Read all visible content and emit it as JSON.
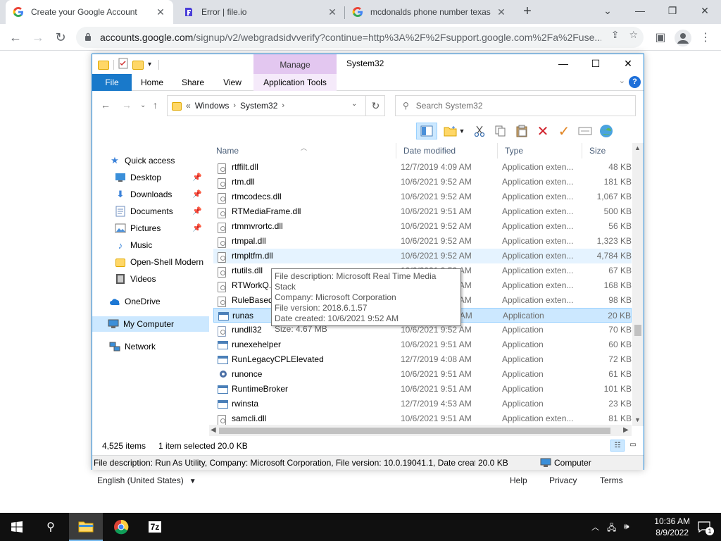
{
  "browser": {
    "tabs": [
      {
        "title": "Create your Google Account",
        "icon": "google-g-icon"
      },
      {
        "title": "Error | file.io",
        "icon": "fileio-icon"
      },
      {
        "title": "mcdonalds phone number texas",
        "icon": "google-g-icon"
      }
    ],
    "url_host": "accounts.google.com",
    "url_path": "/signup/v2/webgradsidvverify?continue=http%3A%2F%2Fsupport.google.com%2Fa%2Fuse..."
  },
  "page": {
    "language": "English (United States)",
    "links": [
      "Help",
      "Privacy",
      "Terms"
    ]
  },
  "explorer": {
    "window_title": "System32",
    "manage_label": "Manage",
    "ribbon_tabs": [
      "File",
      "Home",
      "Share",
      "View",
      "Application Tools"
    ],
    "breadcrumb": [
      "Windows",
      "System32"
    ],
    "breadcrumb_prefix": "«",
    "search_placeholder": "Search System32",
    "nav": {
      "quick_access": "Quick access",
      "items": [
        "Desktop",
        "Downloads",
        "Documents",
        "Pictures",
        "Music",
        "Open-Shell Modern",
        "Videos"
      ],
      "onedrive": "OneDrive",
      "my_computer": "My Computer",
      "network": "Network"
    },
    "columns": [
      "Name",
      "Date modified",
      "Type",
      "Size"
    ],
    "files": [
      {
        "name": "rtffilt.dll",
        "date": "12/7/2019 4:09 AM",
        "type": "Application exten...",
        "size": "48 KB",
        "kind": "dll"
      },
      {
        "name": "rtm.dll",
        "date": "10/6/2021 9:52 AM",
        "type": "Application exten...",
        "size": "181 KB",
        "kind": "dll"
      },
      {
        "name": "rtmcodecs.dll",
        "date": "10/6/2021 9:52 AM",
        "type": "Application exten...",
        "size": "1,067 KB",
        "kind": "dll"
      },
      {
        "name": "RTMediaFrame.dll",
        "date": "10/6/2021 9:51 AM",
        "type": "Application exten...",
        "size": "500 KB",
        "kind": "dll"
      },
      {
        "name": "rtmmvrortc.dll",
        "date": "10/6/2021 9:52 AM",
        "type": "Application exten...",
        "size": "56 KB",
        "kind": "dll"
      },
      {
        "name": "rtmpal.dll",
        "date": "10/6/2021 9:52 AM",
        "type": "Application exten...",
        "size": "1,323 KB",
        "kind": "dll"
      },
      {
        "name": "rtmpltfm.dll",
        "date": "10/6/2021 9:52 AM",
        "type": "Application exten...",
        "size": "4,784 KB",
        "kind": "dll"
      },
      {
        "name": "rtutils.dll",
        "date": "10/6/2021 9:52 AM",
        "type": "Application exten...",
        "size": "67 KB",
        "kind": "dll"
      },
      {
        "name": "RTWorkQ.dll",
        "date": "10/6/2021 9:52 AM",
        "type": "Application exten...",
        "size": "168 KB",
        "kind": "dll"
      },
      {
        "name": "RuleBased",
        "date": "10/6/2021 9:52 AM",
        "type": "Application exten...",
        "size": "98 KB",
        "kind": "dll"
      },
      {
        "name": "runas",
        "date": "10/6/2021 9:52 AM",
        "type": "Application",
        "size": "20 KB",
        "kind": "exe"
      },
      {
        "name": "rundll32",
        "date": "10/6/2021 9:52 AM",
        "type": "Application",
        "size": "70 KB",
        "kind": "file"
      },
      {
        "name": "runexehelper",
        "date": "10/6/2021 9:51 AM",
        "type": "Application",
        "size": "60 KB",
        "kind": "exe"
      },
      {
        "name": "RunLegacyCPLElevated",
        "date": "12/7/2019 4:08 AM",
        "type": "Application",
        "size": "72 KB",
        "kind": "exe"
      },
      {
        "name": "runonce",
        "date": "10/6/2021 9:51 AM",
        "type": "Application",
        "size": "61 KB",
        "kind": "gear"
      },
      {
        "name": "RuntimeBroker",
        "date": "10/6/2021 9:51 AM",
        "type": "Application",
        "size": "101 KB",
        "kind": "exe"
      },
      {
        "name": "rwinsta",
        "date": "12/7/2019 4:53 AM",
        "type": "Application",
        "size": "23 KB",
        "kind": "exe"
      },
      {
        "name": "samcli.dll",
        "date": "10/6/2021 9:51 AM",
        "type": "Application exten...",
        "size": "81 KB",
        "kind": "dll"
      }
    ],
    "tooltip": [
      "File description: Microsoft Real Time Media Stack",
      "Company: Microsoft Corporation",
      "File version: 2018.6.1.57",
      "Date created: 10/6/2021 9:52 AM",
      "Size: 4.67 MB"
    ],
    "status": {
      "items": "4,525 items",
      "selected": "1 item selected",
      "size": "20.0 KB"
    },
    "infobar": {
      "description": "File description: Run As Utility, Company: Microsoft Corporation, File version: 10.0.19041.1, Date created",
      "size": "20.0 KB",
      "location": "Computer"
    }
  },
  "taskbar": {
    "time": "10:36 AM",
    "date": "8/9/2022",
    "notification_count": "1",
    "app_7z": "7z"
  },
  "colors": {
    "file_tab": "#1979ca",
    "manage_tab": "#e3c7f0",
    "selection": "#cce8ff",
    "taskbar": "#101010"
  }
}
